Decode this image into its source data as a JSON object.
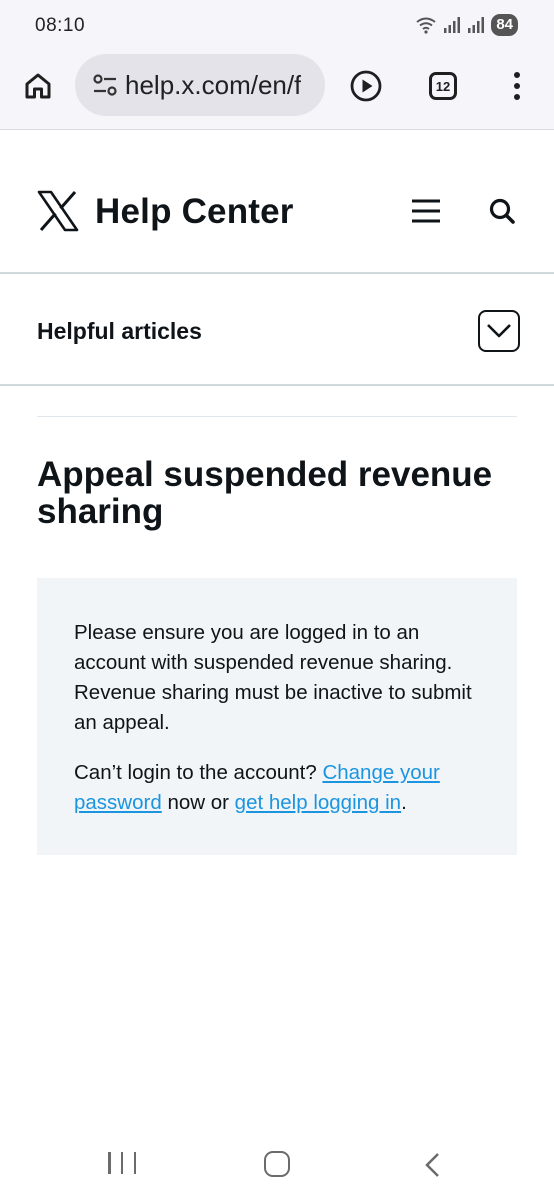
{
  "status_bar": {
    "time": "08:10",
    "battery": "84"
  },
  "browser": {
    "url": "help.x.com/en/f",
    "tab_count": "12"
  },
  "header": {
    "title": "Help Center"
  },
  "helpful_articles": {
    "label": "Helpful articles"
  },
  "article": {
    "title": "Appeal suspended revenue sharing",
    "notice": {
      "paragraph1": "Please ensure you are logged in to an account with suspended revenue sharing. Revenue sharing must be inactive to submit an appeal.",
      "p2_prefix": "Can’t login to the account? ",
      "link_change_password": "Change your password",
      "p2_middle": " now or ",
      "link_help_login": "get help logging in",
      "p2_suffix": "."
    }
  },
  "colors": {
    "link": "#1b95e0",
    "notice_bg": "#f2f5f7",
    "text": "#0f1419"
  }
}
